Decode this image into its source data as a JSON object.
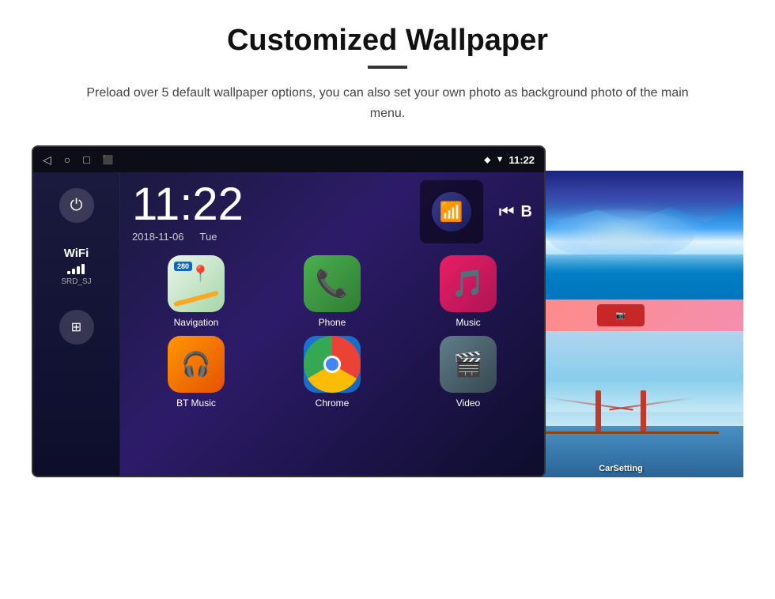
{
  "header": {
    "title": "Customized Wallpaper",
    "description": "Preload over 5 default wallpaper options, you can also set your own photo as background photo of the main menu."
  },
  "status_bar": {
    "time": "11:22",
    "nav_back": "◁",
    "nav_home": "○",
    "nav_recent": "□",
    "nav_screenshot": "⬛",
    "location_icon": "📍",
    "wifi_icon": "▼",
    "signal_icon": "▼"
  },
  "clock": {
    "time": "11:22",
    "date": "2018-11-06",
    "day": "Tue"
  },
  "sidebar": {
    "wifi_label": "WiFi",
    "wifi_ssid": "SRD_SJ"
  },
  "apps": [
    {
      "label": "Navigation",
      "icon_type": "nav"
    },
    {
      "label": "Phone",
      "icon_type": "phone"
    },
    {
      "label": "Music",
      "icon_type": "music"
    },
    {
      "label": "BT Music",
      "icon_type": "bt"
    },
    {
      "label": "Chrome",
      "icon_type": "chrome"
    },
    {
      "label": "Video",
      "icon_type": "video"
    }
  ],
  "wallpaper_label": "CarSetting"
}
